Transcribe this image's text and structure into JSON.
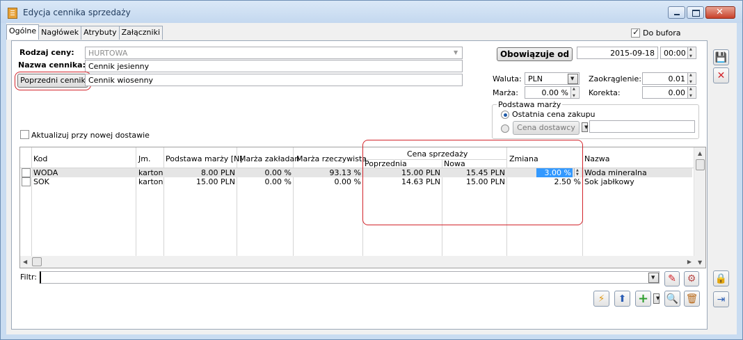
{
  "window": {
    "title": "Edycja cennika sprzedaży"
  },
  "tabs": [
    "Ogólne",
    "Nagłówek",
    "Atrybuty",
    "Załączniki"
  ],
  "do_bufora": {
    "label": "Do bufora",
    "checked": true
  },
  "form": {
    "rodzaj_label": "Rodzaj ceny:",
    "rodzaj_value": "HURTOWA",
    "nazwa_label": "Nazwa cennika:",
    "nazwa_value": "Cennik jesienny",
    "poprzedni_button": "Poprzedni cennik",
    "poprzedni_value": "Cennik wiosenny",
    "aktualizuj_label": "Aktualizuj przy nowej dostawie",
    "obowiazuje_button": "Obowiązuje od",
    "date": "2015-09-18",
    "time": "00:00",
    "waluta_label": "Waluta:",
    "waluta_value": "PLN",
    "marza_label": "Marża:",
    "marza_value": "0.00 %",
    "zaokraglenie_label": "Zaokrąglenie:",
    "zaokraglenie_value": "0.01",
    "korekta_label": "Korekta:",
    "korekta_value": "0.00",
    "podstawa_title": "Podstawa marży",
    "radio_ostatnia": "Ostatnia cena zakupu",
    "cena_dostawcy_button": "Cena dostawcy",
    "cena_dostawcy_value": ""
  },
  "grid": {
    "headers": {
      "kod": "Kod",
      "jm": "Jm.",
      "podstawa": "Podstawa marży [N]",
      "marza_zakl": "Marża zakładan",
      "marza_rzecz": "Marża rzeczywista",
      "cena_group": "Cena sprzedaży",
      "poprzednia": "Poprzednia",
      "nowa": "Nowa",
      "zmiana": "Zmiana",
      "nazwa": "Nazwa"
    },
    "rows": [
      {
        "kod": "WODA",
        "jm": "karton",
        "podstawa": "8.00 PLN",
        "marza_zakl": "0.00 %",
        "marza_rzecz": "93.13 %",
        "poprzednia": "15.00 PLN",
        "nowa": "15.45 PLN",
        "zmiana": "3.00 %",
        "nazwa": "Woda mineralna"
      },
      {
        "kod": "SOK",
        "jm": "karton",
        "podstawa": "15.00 PLN",
        "marza_zakl": "0.00 %",
        "marza_rzecz": "0.00 %",
        "poprzednia": "14.63 PLN",
        "nowa": "15.00 PLN",
        "zmiana": "2.50 %",
        "nazwa": "Sok jabłkowy"
      }
    ]
  },
  "filter": {
    "label": "Filtr:",
    "value": ""
  },
  "colors": {
    "accent": "#d2232a",
    "selection": "#3399ff"
  }
}
